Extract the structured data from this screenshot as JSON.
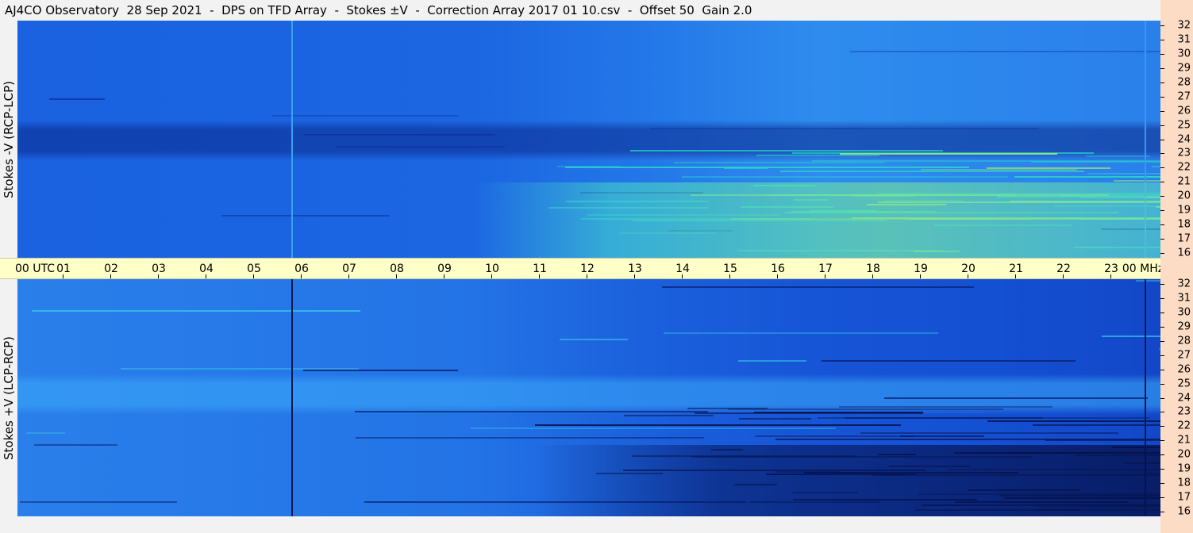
{
  "title": "AJ4CO Observatory  28 Sep 2021  -  DPS on TFD Array  -  Stokes ±V  -  Correction Array 2017 01 10.csv  -  Offset 50  Gain 2.0",
  "top_panel": {
    "ylabel": "Stokes -V (RCP-LCP)"
  },
  "bottom_panel": {
    "ylabel": "Stokes +V (LCP-RCP)"
  },
  "time_axis": {
    "start_label": "00 UTC",
    "hour_labels": [
      "01",
      "02",
      "03",
      "04",
      "05",
      "06",
      "07",
      "08",
      "09",
      "10",
      "11",
      "12",
      "13",
      "14",
      "15",
      "16",
      "17",
      "18",
      "19",
      "20",
      "21",
      "22",
      "23"
    ],
    "end_label": "00 MHz"
  },
  "frequency_axis": {
    "unit": "MHz",
    "labels": [
      "32",
      "31",
      "30",
      "29",
      "28",
      "27",
      "26",
      "25",
      "24",
      "23",
      "22",
      "21",
      "20",
      "19",
      "18",
      "17",
      "16"
    ]
  },
  "colors": {
    "background": "#f2f2f2",
    "time_bar": "#ffffc8",
    "frequency_column": "#fcdcc4",
    "rfi_top": "#2ad7c8",
    "rfi_bottom": "#06124a"
  }
}
